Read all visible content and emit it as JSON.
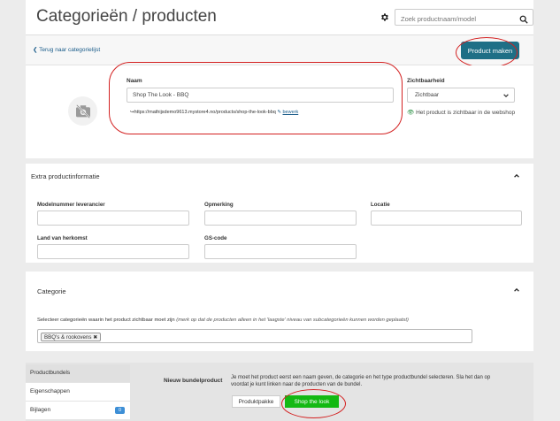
{
  "header": {
    "title": "Categorieën / producten",
    "search_placeholder": "Zoek productnaam/model",
    "gear_icon": "gear-icon",
    "search_icon": "search-icon"
  },
  "backbar": {
    "back_link": "❮ Terug naar categorielijst",
    "create_button": "Product maken"
  },
  "product": {
    "name_label": "Naam",
    "name_value": "Shop The Look - BBQ",
    "url_text": "↪https://mathijsdemo9613.mystore4.no/products/shop-the-look-bbq",
    "url_edit": "bewerk",
    "visibility_label": "Zichtbaarheid",
    "visibility_value": "Zichtbaar",
    "visibility_status": "Het product is zichtbaar in de webshop"
  },
  "extra": {
    "header": "Extra productinformatie",
    "fields": {
      "model_label": "Modelnummer leverancier",
      "note_label": "Opmerking",
      "location_label": "Locatie",
      "country_label": "Land van herkomst",
      "gs_label": "GS-code"
    }
  },
  "category": {
    "header": "Categorie",
    "instruction": "Selecteer categorieën waarin het product zichtbaar moet zijn",
    "instruction_note": "(merk op dat de producten alleen in het 'laagste' niveau van subcategorieën kunnen worden geplaatst)",
    "tag": "BBQ's & rookovens"
  },
  "bottom": {
    "nav": [
      {
        "label": "Productbundels"
      },
      {
        "label": "Eigenschappen"
      },
      {
        "label": "Bijlagen",
        "badge": "0"
      }
    ],
    "bundle_label": "Nieuw bundelproduct",
    "bundle_desc": "Je moet het product eerst een naam geven, de categorie en het type productbundel selecteren. Sla het dan op voordat je kunt linken naar de producten van de bundel.",
    "btn_pakket": "Produktpakke",
    "btn_stl": "Shop the look"
  },
  "colors": {
    "accent": "#1e6f86",
    "highlight_circle": "#d32020",
    "stl_green": "#13b913"
  }
}
